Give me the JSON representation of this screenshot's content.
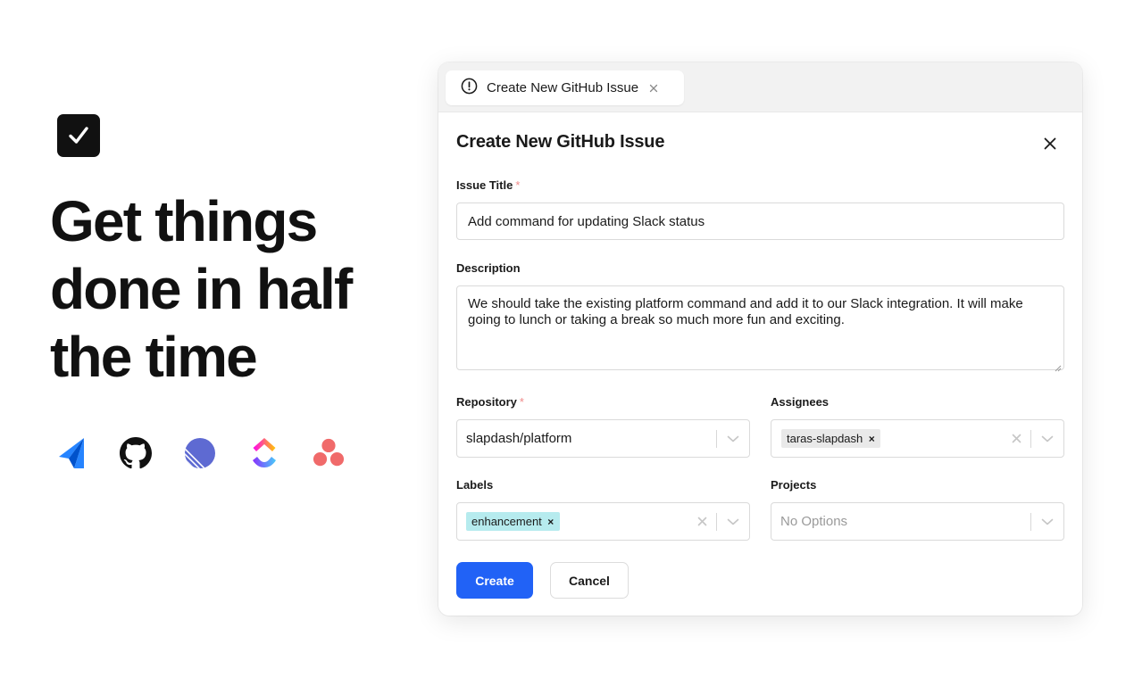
{
  "hero": {
    "headline_lines": [
      "Get things",
      "done in half",
      "the time"
    ],
    "icons": [
      "checkbox-icon",
      "jira-icon",
      "github-icon",
      "linear-icon",
      "clickup-icon",
      "asana-icon"
    ]
  },
  "window": {
    "tab": {
      "label": "Create New GitHub Issue"
    },
    "title": "Create New GitHub Issue",
    "form": {
      "issue_title": {
        "label": "Issue Title",
        "required_mark": "*",
        "value": "Add command for updating Slack status"
      },
      "description": {
        "label": "Description",
        "value": "We should take the existing platform command and add it to our Slack integration. It will make going to lunch or taking a break so much more fun and exciting."
      },
      "repository": {
        "label": "Repository",
        "required_mark": "*",
        "value": "slapdash/platform"
      },
      "assignees": {
        "label": "Assignees",
        "chips": [
          "taras-slapdash"
        ],
        "chip_remove": "×"
      },
      "labels": {
        "label": "Labels",
        "chips": [
          "enhancement"
        ],
        "chip_remove": "×"
      },
      "projects": {
        "label": "Projects",
        "placeholder": "No Options"
      }
    },
    "buttons": {
      "create": "Create",
      "cancel": "Cancel"
    }
  },
  "colors": {
    "primary": "#2162f6",
    "label_chip": "#b6ebee",
    "assignee_chip": "#e9e9e9",
    "required": "#f08a8a"
  }
}
